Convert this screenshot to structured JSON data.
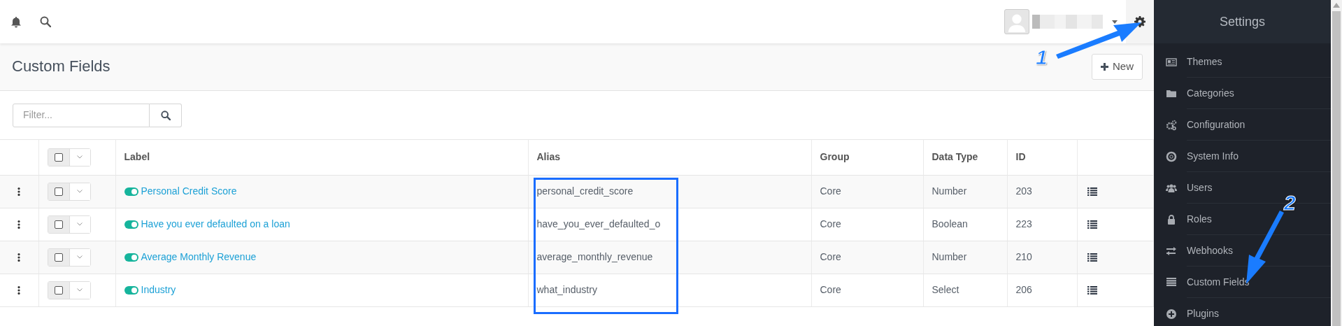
{
  "page_title": "Custom Fields",
  "new_button": "New",
  "filter": {
    "placeholder": "Filter..."
  },
  "table": {
    "columns": [
      "Label",
      "Alias",
      "Group",
      "Data Type",
      "ID"
    ],
    "rows": [
      {
        "label": "Personal Credit Score",
        "enabled": true,
        "alias": "personal_credit_score",
        "group": "Core",
        "data_type": "Number",
        "id": "203"
      },
      {
        "label": "Have you ever defaulted on a loan",
        "enabled": true,
        "alias": "have_you_ever_defaulted_o",
        "group": "Core",
        "data_type": "Boolean",
        "id": "223"
      },
      {
        "label": "Average Monthly Revenue",
        "enabled": true,
        "alias": "average_monthly_revenue",
        "group": "Core",
        "data_type": "Number",
        "id": "210"
      },
      {
        "label": "Industry",
        "enabled": true,
        "alias": "what_industry",
        "group": "Core",
        "data_type": "Select",
        "id": "206"
      }
    ]
  },
  "sidebar": {
    "title": "Settings",
    "items": [
      {
        "label": "Themes"
      },
      {
        "label": "Categories"
      },
      {
        "label": "Configuration"
      },
      {
        "label": "System Info"
      },
      {
        "label": "Users"
      },
      {
        "label": "Roles"
      },
      {
        "label": "Webhooks"
      },
      {
        "label": "Custom Fields"
      },
      {
        "label": "Plugins"
      }
    ]
  },
  "annotations": [
    {
      "number": "1"
    },
    {
      "number": "2"
    }
  ]
}
